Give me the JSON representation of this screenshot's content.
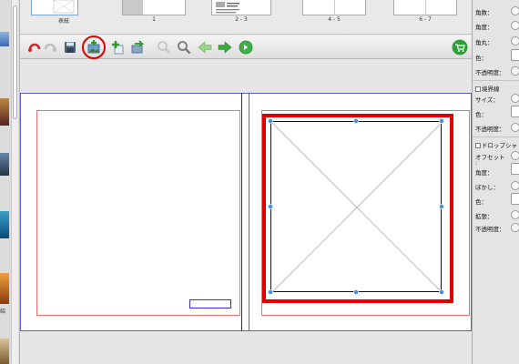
{
  "page_strip": {
    "pages": [
      {
        "label": "表紙",
        "selected": true
      },
      {
        "label": "1"
      },
      {
        "label": "2 - 3"
      },
      {
        "label": "4 - 5"
      },
      {
        "label": "6 - 7"
      }
    ]
  },
  "left_strip": {
    "last_label": "紹"
  },
  "toolbar": {
    "tools": [
      "undo-icon",
      "redo-icon",
      "save-icon",
      "add-image-icon",
      "add-page-icon",
      "export-icon",
      "zoom-out-icon",
      "zoom-in-icon",
      "previous-page-icon",
      "next-page-icon",
      "help-icon",
      "cart-icon"
    ]
  },
  "panel": {
    "kaku": "角数：",
    "kakudo": "角度：",
    "kadomaru": "角丸：",
    "iro": "色：",
    "futomeido": "不透明度：",
    "kyokaisen": "境界線",
    "size": "サイズ：",
    "iro2": "色：",
    "futomeido2": "不透明度：",
    "dropshadow": "ドロップシャ",
    "offset": "オフセット",
    "offset_colon": ":",
    "kakudo2": "角度：",
    "bokashi": "ぼかし：",
    "iro3": "色：",
    "kakucho": "拡張：",
    "futomeido3": "不透明度："
  },
  "colors": {
    "highlight": "#e00000",
    "guide": "#f07070",
    "page_border": "#5b5bd6",
    "handle": "#4a90e2"
  }
}
